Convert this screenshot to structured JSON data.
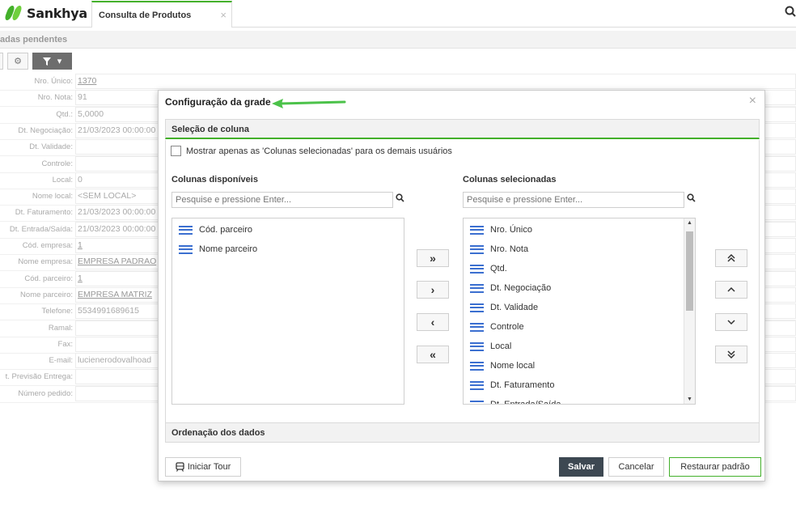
{
  "topbar": {
    "brand": "Sankhya",
    "tab_label": "Consulta de Produtos",
    "tab_close": "×",
    "search_icon": "search-icon"
  },
  "pending": {
    "label": "adas pendentes"
  },
  "toolbar": {
    "gear": "⚙",
    "filter": "▼",
    "caret": "▾"
  },
  "form": {
    "rows": [
      {
        "label": "Nro. Único:",
        "value": "1370",
        "link": true
      },
      {
        "label": "Nro. Nota:",
        "value": "91"
      },
      {
        "label": "Qtd.:",
        "value": "5,0000"
      },
      {
        "label": "Dt. Negociação:",
        "value": "21/03/2023 00:00:00"
      },
      {
        "label": "Dt. Validade:",
        "value": ""
      },
      {
        "label": "Controle:",
        "value": ""
      },
      {
        "label": "Local:",
        "value": "0"
      },
      {
        "label": "Nome local:",
        "value": "<SEM LOCAL>"
      },
      {
        "label": "Dt. Faturamento:",
        "value": "21/03/2023 00:00:00"
      },
      {
        "label": "Dt. Entrada/Saída:",
        "value": "21/03/2023 00:00:00"
      },
      {
        "label": "Cód. empresa:",
        "value": "1",
        "link": true
      },
      {
        "label": "Nome empresa:",
        "value": "EMPRESA PADRAO",
        "link": true
      },
      {
        "label": "Cód. parceiro:",
        "value": "1",
        "link": true
      },
      {
        "label": "Nome parceiro:",
        "value": "EMPRESA MATRIZ",
        "link": true
      },
      {
        "label": "Telefone:",
        "value": "5534991689615"
      },
      {
        "label": "Ramal:",
        "value": ""
      },
      {
        "label": "Fax:",
        "value": ""
      },
      {
        "label": "E-mail:",
        "value": "lucienerodovalhoad"
      },
      {
        "label": "t. Previsão Entrega:",
        "value": ""
      },
      {
        "label": "Número pedido:",
        "value": ""
      }
    ]
  },
  "dialog": {
    "title": "Configuração da grade",
    "close": "×",
    "section1": "Seleção de coluna",
    "checkbox_label": "Mostrar apenas as 'Colunas selecionadas' para os demais usuários",
    "available_title": "Colunas disponíveis",
    "selected_title": "Colunas selecionadas",
    "search_placeholder": "Pesquise e pressione Enter...",
    "available": [
      "Cód. parceiro",
      "Nome parceiro"
    ],
    "selected": [
      "Nro. Único",
      "Nro. Nota",
      "Qtd.",
      "Dt. Negociação",
      "Dt. Validade",
      "Controle",
      "Local",
      "Nome local",
      "Dt. Faturamento",
      "Dt. Entrada/Saída"
    ],
    "move_all_right": "»",
    "move_right": "›",
    "move_left": "‹",
    "move_all_left": "«",
    "top": "⌃",
    "up": "^",
    "down": "⌄",
    "bottom": "⌄",
    "section2": "Ordenação dos dados",
    "tour": "Iniciar Tour",
    "save": "Salvar",
    "cancel": "Cancelar",
    "restore": "Restaurar padrão"
  }
}
